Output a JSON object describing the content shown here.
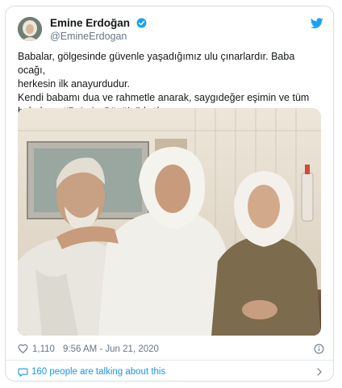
{
  "tweet": {
    "author_name": "Emine Erdoğan",
    "author_handle": "@EmineErdogan",
    "text_line1": "Babalar, gölgesinde güvenle yaşadığımız ulu çınarlardır. Baba ocağı,",
    "text_line2": "herkesin ilk anayurdudur.",
    "text_line3": "Kendi babamı dua ve rahmetle anarak, saygıdeğer eşimin ve tüm",
    "text_line4_prefix": "babaların ",
    "hashtag": "#BabalarGünü",
    "text_line4_suffix": "'nü kutluyorum.",
    "likes": "1,110",
    "timestamp": "9:56 AM - Jun 21, 2020",
    "talking": "160 people are talking about this"
  },
  "icons": {
    "verified": "verified-badge-icon",
    "brand": "twitter-bird-icon",
    "like": "heart-icon",
    "info": "info-icon",
    "conversation": "speech-bubble-icon",
    "more": "chevron-right-icon"
  },
  "colors": {
    "twitter_blue": "#1da1f2",
    "link": "#1b95e0",
    "muted": "#657786",
    "text": "#14171a"
  }
}
